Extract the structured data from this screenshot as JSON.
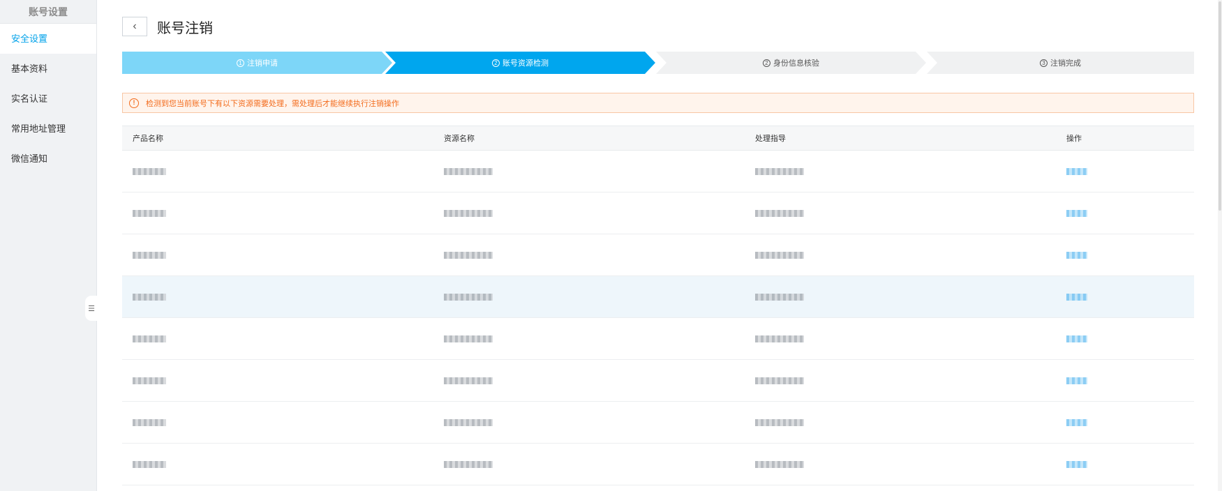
{
  "sidebar": {
    "title": "账号设置",
    "items": [
      {
        "label": "安全设置",
        "active": true
      },
      {
        "label": "基本资料",
        "active": false
      },
      {
        "label": "实名认证",
        "active": false
      },
      {
        "label": "常用地址管理",
        "active": false
      },
      {
        "label": "微信通知",
        "active": false
      }
    ],
    "collapse_icon": "list-collapse-icon"
  },
  "header": {
    "back_icon": "chevron-left-icon",
    "title": "账号注销"
  },
  "steps": [
    {
      "num": "1",
      "label": "注销申请",
      "state": "done"
    },
    {
      "num": "2",
      "label": "账号资源检测",
      "state": "current"
    },
    {
      "num": "2",
      "label": "身份信息核验",
      "state": "todo"
    },
    {
      "num": "3",
      "label": "注销完成",
      "state": "todo"
    }
  ],
  "alert": {
    "icon": "warning-circle-icon",
    "text": "检测到您当前账号下有以下资源需要处理，需处理后才能继续执行注销操作"
  },
  "table": {
    "columns": [
      "产品名称",
      "资源名称",
      "处理指导",
      "操作"
    ],
    "row_count": 8,
    "highlight_row": 3,
    "note": "cell contents are pixelated in the screenshot"
  },
  "colors": {
    "accent": "#00a6ee",
    "step_done": "#7dd6f8",
    "warning": "#f36b1c"
  }
}
